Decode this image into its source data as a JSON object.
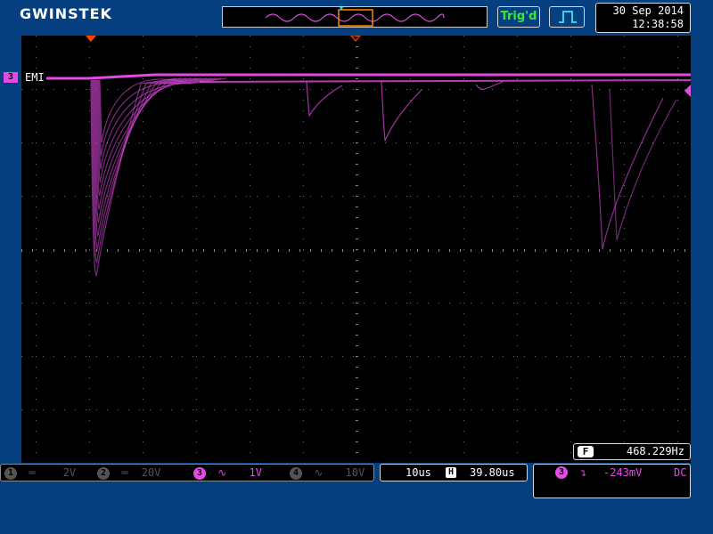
{
  "brand": {
    "logo": "GWINSTEK"
  },
  "status": {
    "trigger_status": "Trig'd",
    "acquire_mode_icon": "pulse-icon"
  },
  "datetime": {
    "date": "30 Sep 2014",
    "time": "12:38:58"
  },
  "trace": {
    "channel_number": "3",
    "channel_label": "EMI",
    "color": "#e44be4"
  },
  "frequency": {
    "badge": "F",
    "value": "468.229Hz"
  },
  "channels": [
    {
      "number": "1",
      "coupling": "dc-coupling-icon",
      "scale": "2V",
      "active": false
    },
    {
      "number": "2",
      "coupling": "dc-coupling-icon",
      "scale": "20V",
      "active": false
    },
    {
      "number": "3",
      "coupling": "ac-coupling-icon",
      "scale": "1V",
      "active": true
    },
    {
      "number": "4",
      "coupling": "ac-coupling-icon",
      "scale": "10V",
      "active": false
    }
  ],
  "timebase": {
    "scale": "10us",
    "position_icon": "horizontal-position-icon",
    "position": "39.80us"
  },
  "trigger": {
    "source": "3",
    "slope_icon": "falling-edge-icon",
    "level": "-243mV",
    "coupling": "DC"
  },
  "colors": {
    "background": "#063f80",
    "trace": "#e44be4",
    "trig_status": "#38e838",
    "marker": "#ff4400"
  }
}
